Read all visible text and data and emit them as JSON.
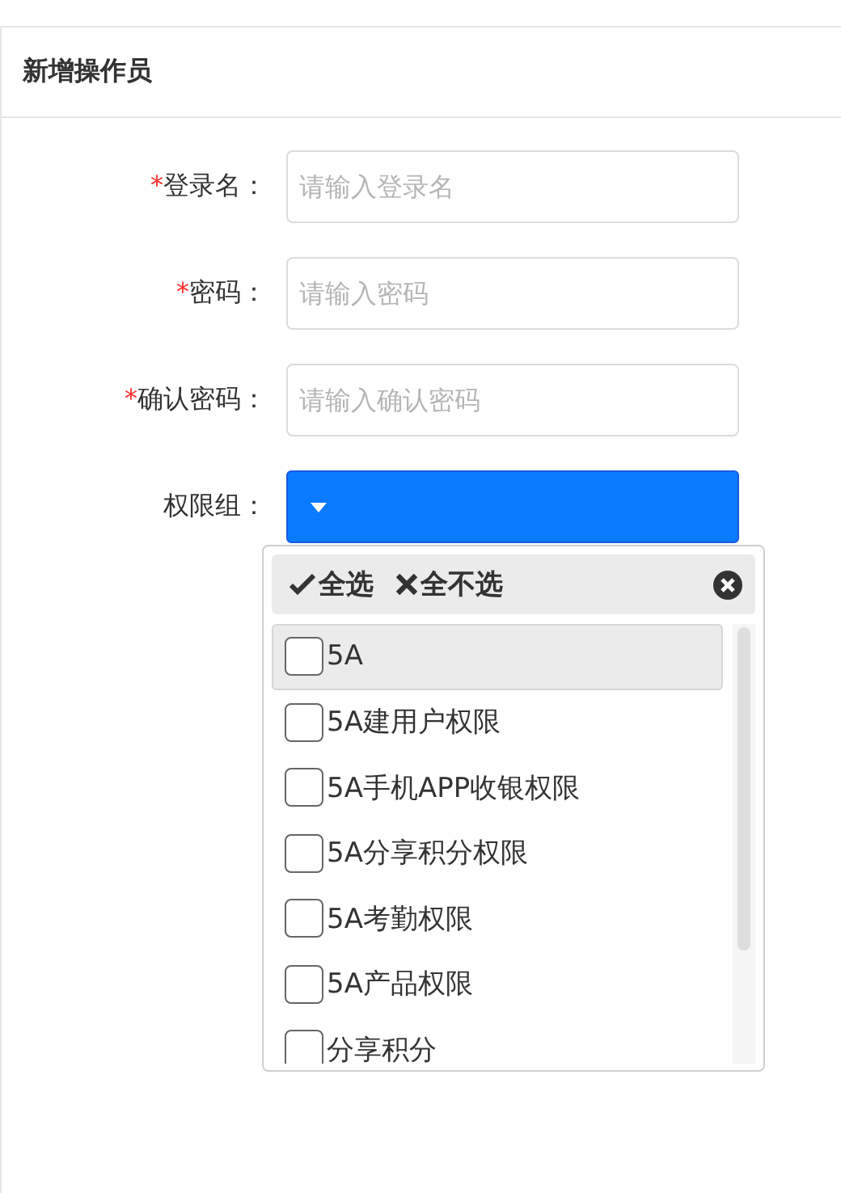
{
  "panel": {
    "title": "新增操作员"
  },
  "fields": [
    {
      "label": "登录名：",
      "required_mark": "*",
      "placeholder": "请输入登录名"
    },
    {
      "label": "密码：",
      "required_mark": "*",
      "placeholder": "请输入密码"
    },
    {
      "label": "确认密码：",
      "required_mark": "*",
      "placeholder": "请输入确认密码"
    }
  ],
  "select": {
    "label": "权限组：",
    "expanded": true
  },
  "dropdown": {
    "select_all": "全选",
    "select_none": "全不选",
    "options": [
      {
        "label": "5A",
        "checked": false,
        "highlighted": true
      },
      {
        "label": "5A建用户权限",
        "checked": false,
        "highlighted": false
      },
      {
        "label": "5A手机APP收银权限",
        "checked": false,
        "highlighted": false
      },
      {
        "label": "5A分享积分权限",
        "checked": false,
        "highlighted": false
      },
      {
        "label": "5A考勤权限",
        "checked": false,
        "highlighted": false
      },
      {
        "label": "5A产品权限",
        "checked": false,
        "highlighted": false
      },
      {
        "label": "分享积分",
        "checked": false,
        "highlighted": false
      }
    ]
  }
}
